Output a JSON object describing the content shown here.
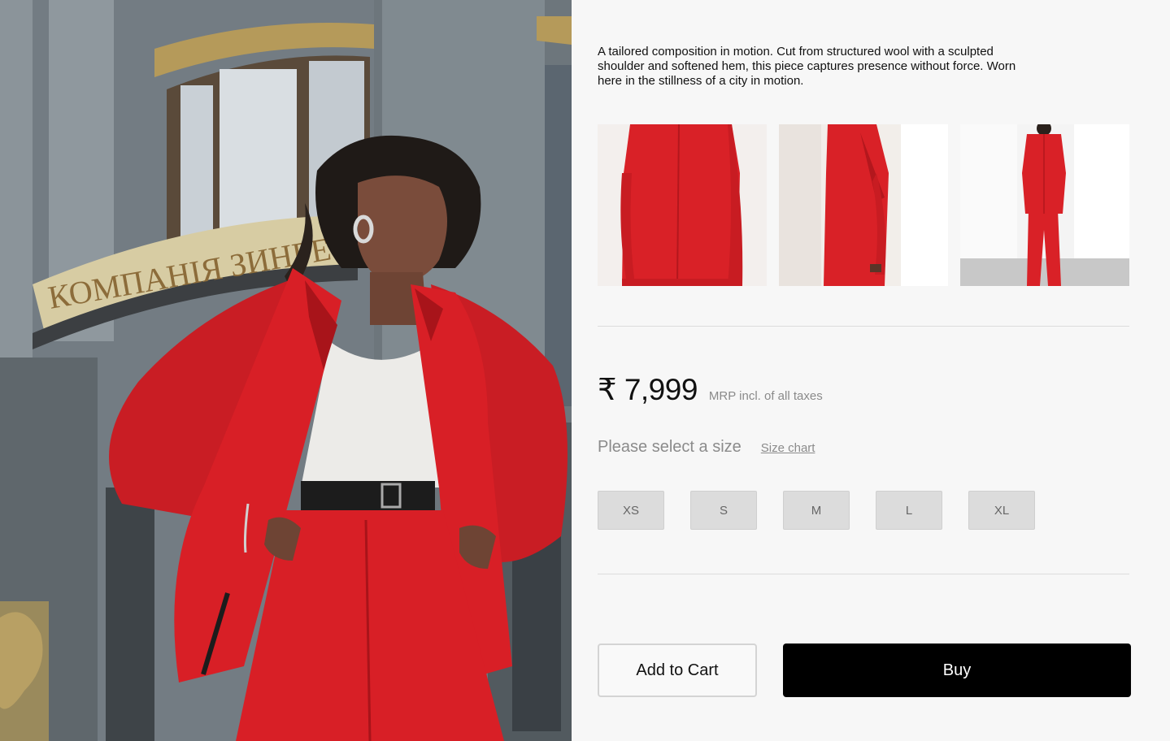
{
  "product": {
    "description": "A tailored composition in motion. Cut from structured wool with a sculpted shoulder and softened hem, this piece captures presence without force. Worn here in the stillness of a city in motion.",
    "price": "₹ 7,999",
    "price_note": "MRP incl. of all taxes"
  },
  "hero": {
    "sign_text": "КОМПАНIЯ ЗИНГЕ"
  },
  "size_selector": {
    "prompt": "Please select a size",
    "chart_link": "Size chart",
    "sizes": [
      "XS",
      "S",
      "M",
      "L",
      "XL"
    ]
  },
  "actions": {
    "add_to_cart": "Add to Cart",
    "buy": "Buy"
  },
  "colors": {
    "garment_red": "#d81f26",
    "buy_button": "#000000",
    "panel_background": "#f7f7f7"
  }
}
